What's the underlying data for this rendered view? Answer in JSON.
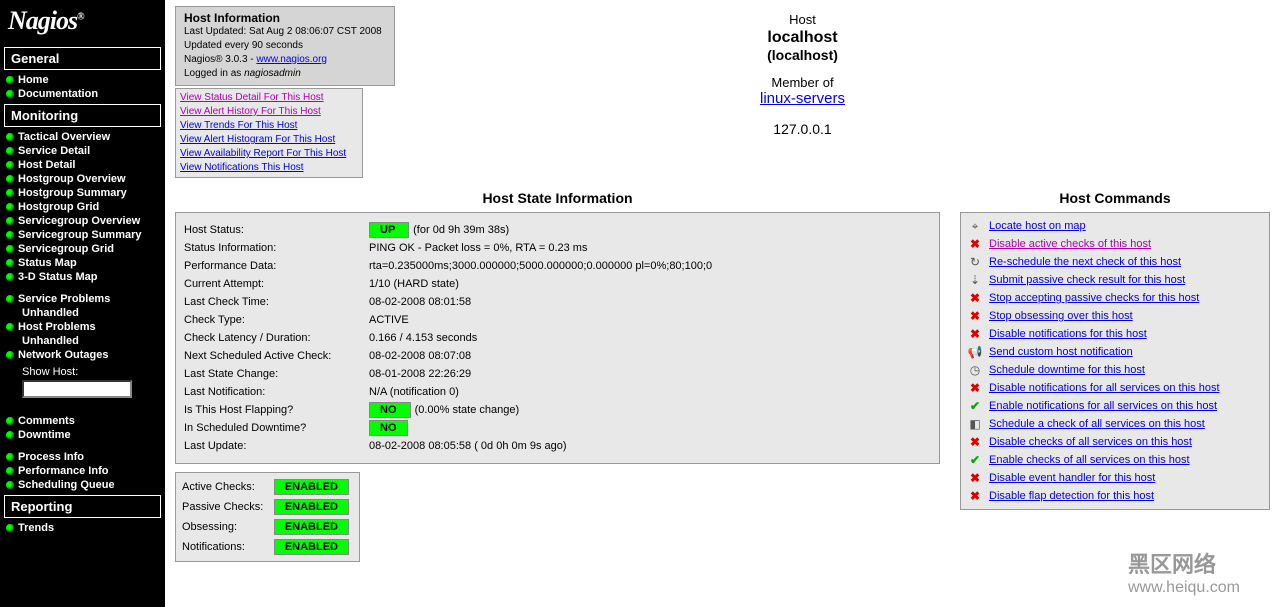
{
  "logo": "Nagios",
  "sidebar": {
    "sections": [
      {
        "title": "General",
        "items": [
          "Home",
          "Documentation"
        ]
      },
      {
        "title": "Monitoring",
        "items": [
          "Tactical Overview",
          "Service Detail",
          "Host Detail",
          "Hostgroup Overview",
          "Hostgroup Summary",
          "Hostgroup Grid",
          "Servicegroup Overview",
          "Servicegroup Summary",
          "Servicegroup Grid",
          "Status Map",
          "3-D Status Map"
        ]
      },
      {
        "title": null,
        "items": [
          "Service Problems",
          "Unhandled",
          "Host Problems",
          "Unhandled",
          "Network Outages"
        ]
      },
      {
        "title": null,
        "items": [
          "Comments",
          "Downtime"
        ]
      },
      {
        "title": null,
        "items": [
          "Process Info",
          "Performance Info",
          "Scheduling Queue"
        ]
      },
      {
        "title": "Reporting",
        "items": [
          "Trends"
        ]
      }
    ],
    "show_host_label": "Show Host:"
  },
  "info_box": {
    "title": "Host Information",
    "last_updated": "Last Updated: Sat Aug 2 08:06:07 CST 2008",
    "updated_every": "Updated every 90 seconds",
    "version_pre": "Nagios® 3.0.3 - ",
    "version_link": "www.nagios.org",
    "logged_in_pre": "Logged in as ",
    "logged_in_user": "nagiosadmin"
  },
  "host_links": [
    "View Status Detail For This Host",
    "View Alert History For This Host",
    "View Trends For This Host",
    "View Alert Histogram For This Host",
    "View Availability Report For This Host",
    "View Notifications This Host"
  ],
  "host_header": {
    "label": "Host",
    "name": "localhost",
    "alias": "(localhost)",
    "member_label": "Member of",
    "group": "linux-servers",
    "ip": "127.0.0.1"
  },
  "state_title": "Host State Information",
  "commands_title": "Host Commands",
  "state": [
    {
      "key": "Host Status:",
      "badge": "UP",
      "val": "(for 0d 9h 39m 38s)"
    },
    {
      "key": "Status Information:",
      "val": "PING OK - Packet loss = 0%, RTA = 0.23 ms"
    },
    {
      "key": "Performance Data:",
      "val": "rta=0.235000ms;3000.000000;5000.000000;0.000000 pl=0%;80;100;0"
    },
    {
      "key": "Current Attempt:",
      "val": "1/10  (HARD state)"
    },
    {
      "key": "Last Check Time:",
      "val": "08-02-2008 08:01:58"
    },
    {
      "key": "Check Type:",
      "val": "ACTIVE"
    },
    {
      "key": "Check Latency / Duration:",
      "val": "0.166 / 4.153 seconds"
    },
    {
      "key": "Next Scheduled Active Check:",
      "val": "08-02-2008 08:07:08"
    },
    {
      "key": "Last State Change:",
      "val": "08-01-2008 22:26:29"
    },
    {
      "key": "Last Notification:",
      "val": "N/A (notification 0)"
    },
    {
      "key": "Is This Host Flapping?",
      "badge": "NO",
      "val": "(0.00% state change)"
    },
    {
      "key": "In Scheduled Downtime?",
      "badge": "NO",
      "val": ""
    },
    {
      "key": "Last Update:",
      "val": "08-02-2008 08:05:58  ( 0d 0h 0m 9s ago)"
    }
  ],
  "checks": [
    {
      "key": "Active Checks:",
      "val": "ENABLED"
    },
    {
      "key": "Passive Checks:",
      "val": "ENABLED"
    },
    {
      "key": "Obsessing:",
      "val": "ENABLED"
    },
    {
      "key": "Notifications:",
      "val": "ENABLED"
    }
  ],
  "commands": [
    {
      "icon": "locate",
      "text": "Locate host on map",
      "visited": false
    },
    {
      "icon": "x",
      "text": "Disable active checks of this host",
      "visited": true
    },
    {
      "icon": "resched",
      "text": "Re-schedule the next check of this host",
      "visited": false
    },
    {
      "icon": "passive",
      "text": "Submit passive check result for this host",
      "visited": false
    },
    {
      "icon": "x",
      "text": "Stop accepting passive checks for this host",
      "visited": false
    },
    {
      "icon": "x",
      "text": "Stop obsessing over this host",
      "visited": false
    },
    {
      "icon": "x",
      "text": "Disable notifications for this host",
      "visited": false
    },
    {
      "icon": "notify",
      "text": "Send custom host notification",
      "visited": false
    },
    {
      "icon": "clock",
      "text": "Schedule downtime for this host",
      "visited": false
    },
    {
      "icon": "x",
      "text": "Disable notifications for all services on this host",
      "visited": false
    },
    {
      "icon": "check",
      "text": "Enable notifications for all services on this host",
      "visited": false
    },
    {
      "icon": "sched",
      "text": "Schedule a check of all services on this host",
      "visited": false
    },
    {
      "icon": "x",
      "text": "Disable checks of all services on this host",
      "visited": false
    },
    {
      "icon": "check",
      "text": "Enable checks of all services on this host",
      "visited": false
    },
    {
      "icon": "x",
      "text": "Disable event handler for this host",
      "visited": false
    },
    {
      "icon": "x",
      "text": "Disable flap detection for this host",
      "visited": false
    }
  ],
  "watermark": {
    "big": "黑区网络",
    "small": "www.heiqu.com"
  }
}
